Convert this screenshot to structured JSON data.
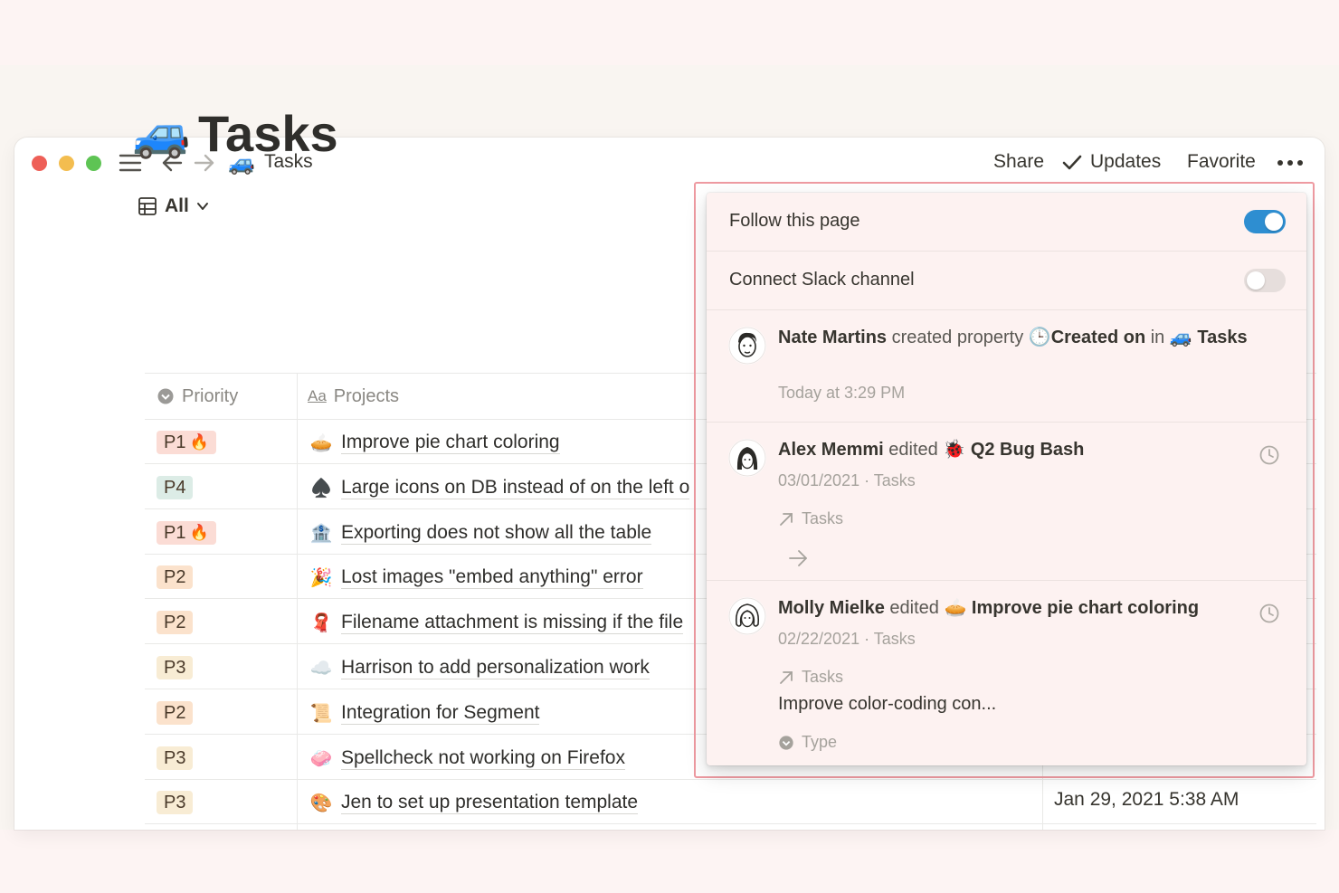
{
  "window": {
    "page_title": "Tasks",
    "page_emoji": "🚙",
    "share_label": "Share",
    "updates_label": "Updates",
    "favorite_label": "Favorite"
  },
  "page": {
    "icon": "🚙",
    "title": "Tasks",
    "view_label": "All"
  },
  "table": {
    "columns": {
      "priority": "Priority",
      "projects_prefix": "Aa",
      "projects": "Projects"
    },
    "rows": [
      {
        "priority": "P1",
        "fire": "🔥",
        "emoji": "🥧",
        "project": "Improve pie chart coloring"
      },
      {
        "priority": "P4",
        "fire": "",
        "emoji": "♠️",
        "project": "Large icons on DB instead of on the left o"
      },
      {
        "priority": "P1",
        "fire": "🔥",
        "emoji": "🏦",
        "project": "Exporting does not show all the table"
      },
      {
        "priority": "P2",
        "fire": "",
        "emoji": "🎉",
        "project": "Lost images \"embed anything\" error"
      },
      {
        "priority": "P2",
        "fire": "",
        "emoji": "🧣",
        "project": "Filename attachment is missing if the file"
      },
      {
        "priority": "P3",
        "fire": "",
        "emoji": "☁️",
        "project": "Harrison to add personalization work"
      },
      {
        "priority": "P2",
        "fire": "",
        "emoji": "📜",
        "project": "Integration for Segment"
      },
      {
        "priority": "P3",
        "fire": "",
        "emoji": "🧼",
        "project": "Spellcheck not working on Firefox"
      },
      {
        "priority": "P3",
        "fire": "",
        "emoji": "🎨",
        "project": "Jen to set up presentation template",
        "date": "Jan 29, 2021 5:38 AM"
      }
    ]
  },
  "updates_panel": {
    "follow_label": "Follow this page",
    "follow_on": true,
    "slack_label": "Connect Slack channel",
    "slack_on": false,
    "activities": [
      {
        "user": "Nate Martins",
        "action": "created property",
        "property_icon": "🕒",
        "property": "Created on",
        "in_word": "in",
        "page_emoji": "🚙",
        "page": "Tasks",
        "time": "Today at 3:29 PM"
      },
      {
        "user": "Alex Memmi",
        "action": "edited",
        "page_emoji": "🐞",
        "page": "Q2 Bug Bash",
        "date": "03/01/2021",
        "separator": "·",
        "location": "Tasks",
        "link_label": "Tasks"
      },
      {
        "user": "Molly Mielke",
        "action": "edited",
        "page_emoji": "🥧",
        "page": "Improve pie chart coloring",
        "date": "02/22/2021",
        "separator": "·",
        "location": "Tasks",
        "link_label": "Tasks",
        "excerpt": "Improve color-coding con...",
        "property_label": "Type"
      }
    ]
  },
  "colors": {
    "toggle_on": "#2e8ed1",
    "highlight_border": "#ee9aa1",
    "panel_bg": "#fdf2f1"
  },
  "icons": [
    "menu-icon",
    "back-arrow-icon",
    "forward-arrow-icon",
    "check-icon",
    "more-icon",
    "table-icon",
    "chevron-down-icon",
    "priority-status-icon",
    "text-property-icon",
    "clock-icon",
    "link-arrow-icon",
    "right-arrow-icon"
  ]
}
